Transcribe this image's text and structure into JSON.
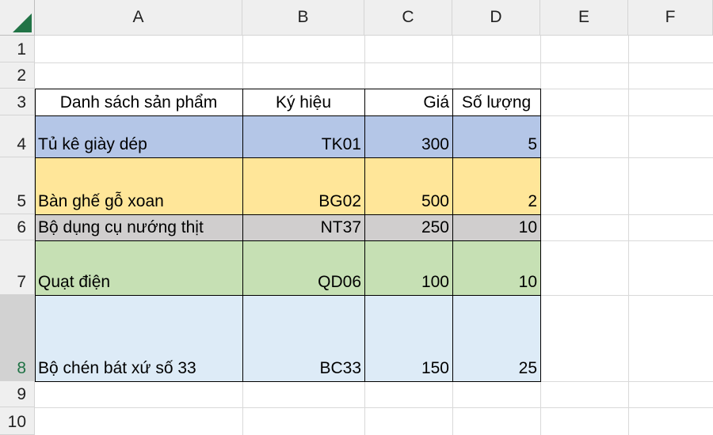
{
  "columns": [
    "A",
    "B",
    "C",
    "D",
    "E",
    "F"
  ],
  "rows": [
    "1",
    "2",
    "3",
    "4",
    "5",
    "6",
    "7",
    "8",
    "9",
    "10"
  ],
  "selected_row": "8",
  "colors": {
    "blue": "#b4c6e7",
    "yellow": "#ffe699",
    "gray": "#d0cece",
    "green": "#c6e0b4",
    "lightblue": "#ddebf7",
    "accent": "#217346"
  },
  "table": {
    "headers": [
      "Danh sách sản phẩm",
      "Ký hiệu",
      "Giá",
      "Số lượng"
    ],
    "rows": [
      [
        "Tủ kê giày dép",
        "TK01",
        "300",
        "5"
      ],
      [
        "Bàn ghế gỗ xoan",
        "BG02",
        "500",
        "2"
      ],
      [
        "Bộ dụng cụ nướng thịt",
        "NT37",
        "250",
        "10"
      ],
      [
        "Quạt điện",
        "QD06",
        "100",
        "10"
      ],
      [
        "Bộ chén bát xứ số 33",
        "BC33",
        "150",
        "25"
      ]
    ]
  }
}
